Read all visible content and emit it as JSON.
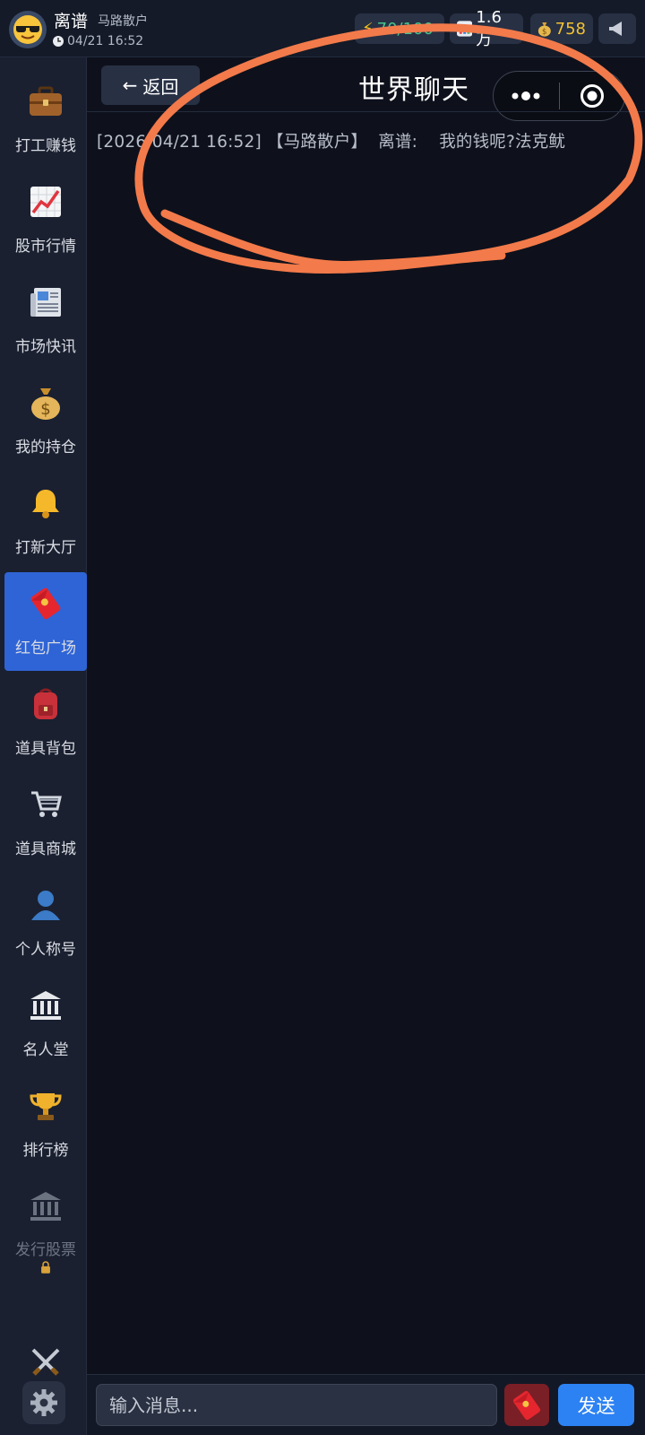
{
  "user": {
    "name": "离谱",
    "rank": "马路散户",
    "time": "04/21 16:52"
  },
  "stats": {
    "energy": "70/100",
    "assets": "1.6万",
    "coins": "758"
  },
  "sidebar": {
    "items": [
      {
        "label": "打工赚钱",
        "icon": "briefcase-icon"
      },
      {
        "label": "股市行情",
        "icon": "chart-icon"
      },
      {
        "label": "市场快讯",
        "icon": "newspaper-icon"
      },
      {
        "label": "我的持仓",
        "icon": "money-bag-icon"
      },
      {
        "label": "打新大厅",
        "icon": "bell-icon"
      },
      {
        "label": "红包广场",
        "icon": "red-envelope-icon",
        "active": true
      },
      {
        "label": "道具背包",
        "icon": "backpack-icon"
      },
      {
        "label": "道具商城",
        "icon": "cart-icon"
      },
      {
        "label": "个人称号",
        "icon": "person-icon"
      },
      {
        "label": "名人堂",
        "icon": "bank-icon"
      },
      {
        "label": "排行榜",
        "icon": "trophy-icon"
      },
      {
        "label": "发行股票",
        "icon": "stock-issue-icon",
        "locked": true
      },
      {
        "label": "",
        "icon": "crossed-swords-icon"
      }
    ]
  },
  "header": {
    "back_label": "返回",
    "title": "世界聊天"
  },
  "messages": [
    {
      "timestamp": "[2026/04/21 16:52]",
      "rank": "【马路散户】",
      "sender": "离谱:",
      "text": "我的钱呢?法克鱿"
    }
  ],
  "input": {
    "placeholder": "输入消息...",
    "send_label": "发送"
  },
  "colors": {
    "accent": "#2d82f3",
    "annotation": "#f37a4a",
    "background": "#0e111c",
    "sidebar_active": "#2f64d6"
  }
}
